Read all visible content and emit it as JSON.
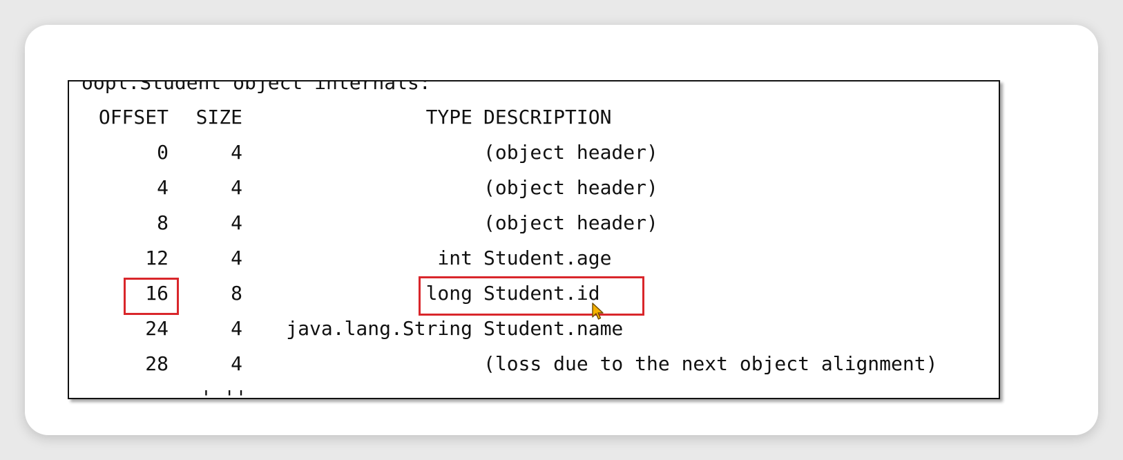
{
  "terminal": {
    "title": "oopl.Student object internals:",
    "headers": {
      "offset": "OFFSET",
      "size": "SIZE",
      "type": "TYPE",
      "description": "DESCRIPTION"
    },
    "rows": [
      {
        "offset": "0",
        "size": "4",
        "type": "",
        "description": "(object header)"
      },
      {
        "offset": "4",
        "size": "4",
        "type": "",
        "description": "(object header)"
      },
      {
        "offset": "8",
        "size": "4",
        "type": "",
        "description": "(object header)"
      },
      {
        "offset": "12",
        "size": "4",
        "type": "int",
        "description": "Student.age"
      },
      {
        "offset": "16",
        "size": "8",
        "type": "long",
        "description": "Student.id"
      },
      {
        "offset": "24",
        "size": "4",
        "type": "java.lang.String",
        "description": "Student.name"
      },
      {
        "offset": "28",
        "size": "4",
        "type": "",
        "description": "(loss due to the next object alignment)"
      }
    ],
    "cut_line_text": "' ''"
  },
  "colors": {
    "highlight": "#d9262b",
    "text": "#111111",
    "background": "#ffffff"
  },
  "icons": {
    "cursor": "mouse-pointer-icon"
  }
}
